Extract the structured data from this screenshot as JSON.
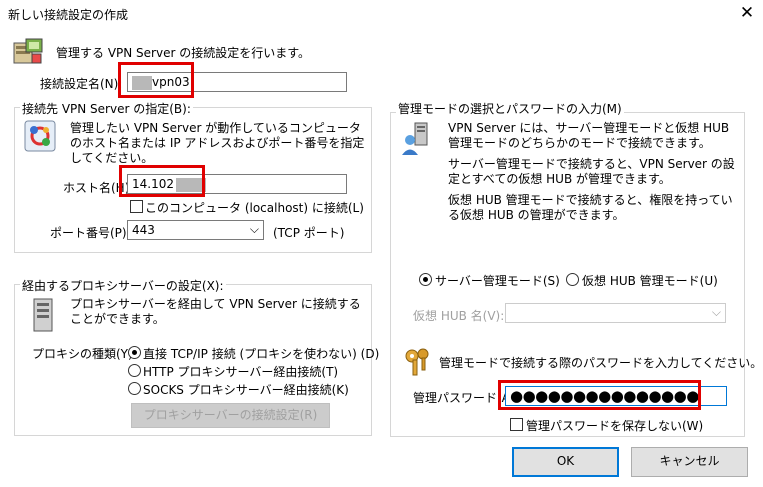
{
  "window": {
    "title": "新しい接続設定の作成",
    "close_glyph": "✕"
  },
  "header": {
    "text": "管理する VPN Server の接続設定を行います。"
  },
  "connection_name": {
    "label": "接続設定名(N):",
    "value": "vpn03"
  },
  "server_group": {
    "legend": "接続先 VPN Server の指定(B):",
    "description": "管理したい VPN Server が動作しているコンピュータのホスト名または IP アドレスおよびポート番号を指定してください。",
    "host_label": "ホスト名(H):",
    "host_value": "14.102",
    "localhost_label": "このコンピュータ (localhost) に接続(L)",
    "port_label": "ポート番号(P):",
    "port_value": "443",
    "port_suffix": "(TCP ポート)"
  },
  "proxy_group": {
    "legend": "経由するプロキシサーバーの設定(X):",
    "description": "プロキシサーバーを経由して VPN Server に接続することができます。",
    "type_label": "プロキシの種類(Y):",
    "options": [
      "直接 TCP/IP 接続 (プロキシを使わない) (D)",
      "HTTP プロキシサーバー経由接続(T)",
      "SOCKS プロキシサーバー経由接続(K)"
    ],
    "settings_button": "プロキシサーバーの接続設定(R)"
  },
  "mode_group": {
    "legend": "管理モードの選択とパスワードの入力(M)",
    "desc1": "VPN Server には、サーバー管理モードと仮想 HUB 管理モードのどちらかのモードで接続できます。",
    "desc2": "サーバー管理モードで接続すると、VPN Server の設定とすべての仮想 HUB が管理できます。",
    "desc3": "仮想 HUB 管理モードで接続すると、権限を持っている仮想 HUB の管理ができます。",
    "server_mode": "サーバー管理モード(S)",
    "hub_mode": "仮想 HUB 管理モード(U)",
    "hub_name_label": "仮想 HUB 名(V):",
    "password_prompt": "管理モードで接続する際のパスワードを入力してください。",
    "password_label": "管理パスワード(A):",
    "password_value": "●●●●●●●●●●●●●●●",
    "no_save_label": "管理パスワードを保存しない(W)"
  },
  "buttons": {
    "ok": "OK",
    "cancel": "キャンセル"
  }
}
